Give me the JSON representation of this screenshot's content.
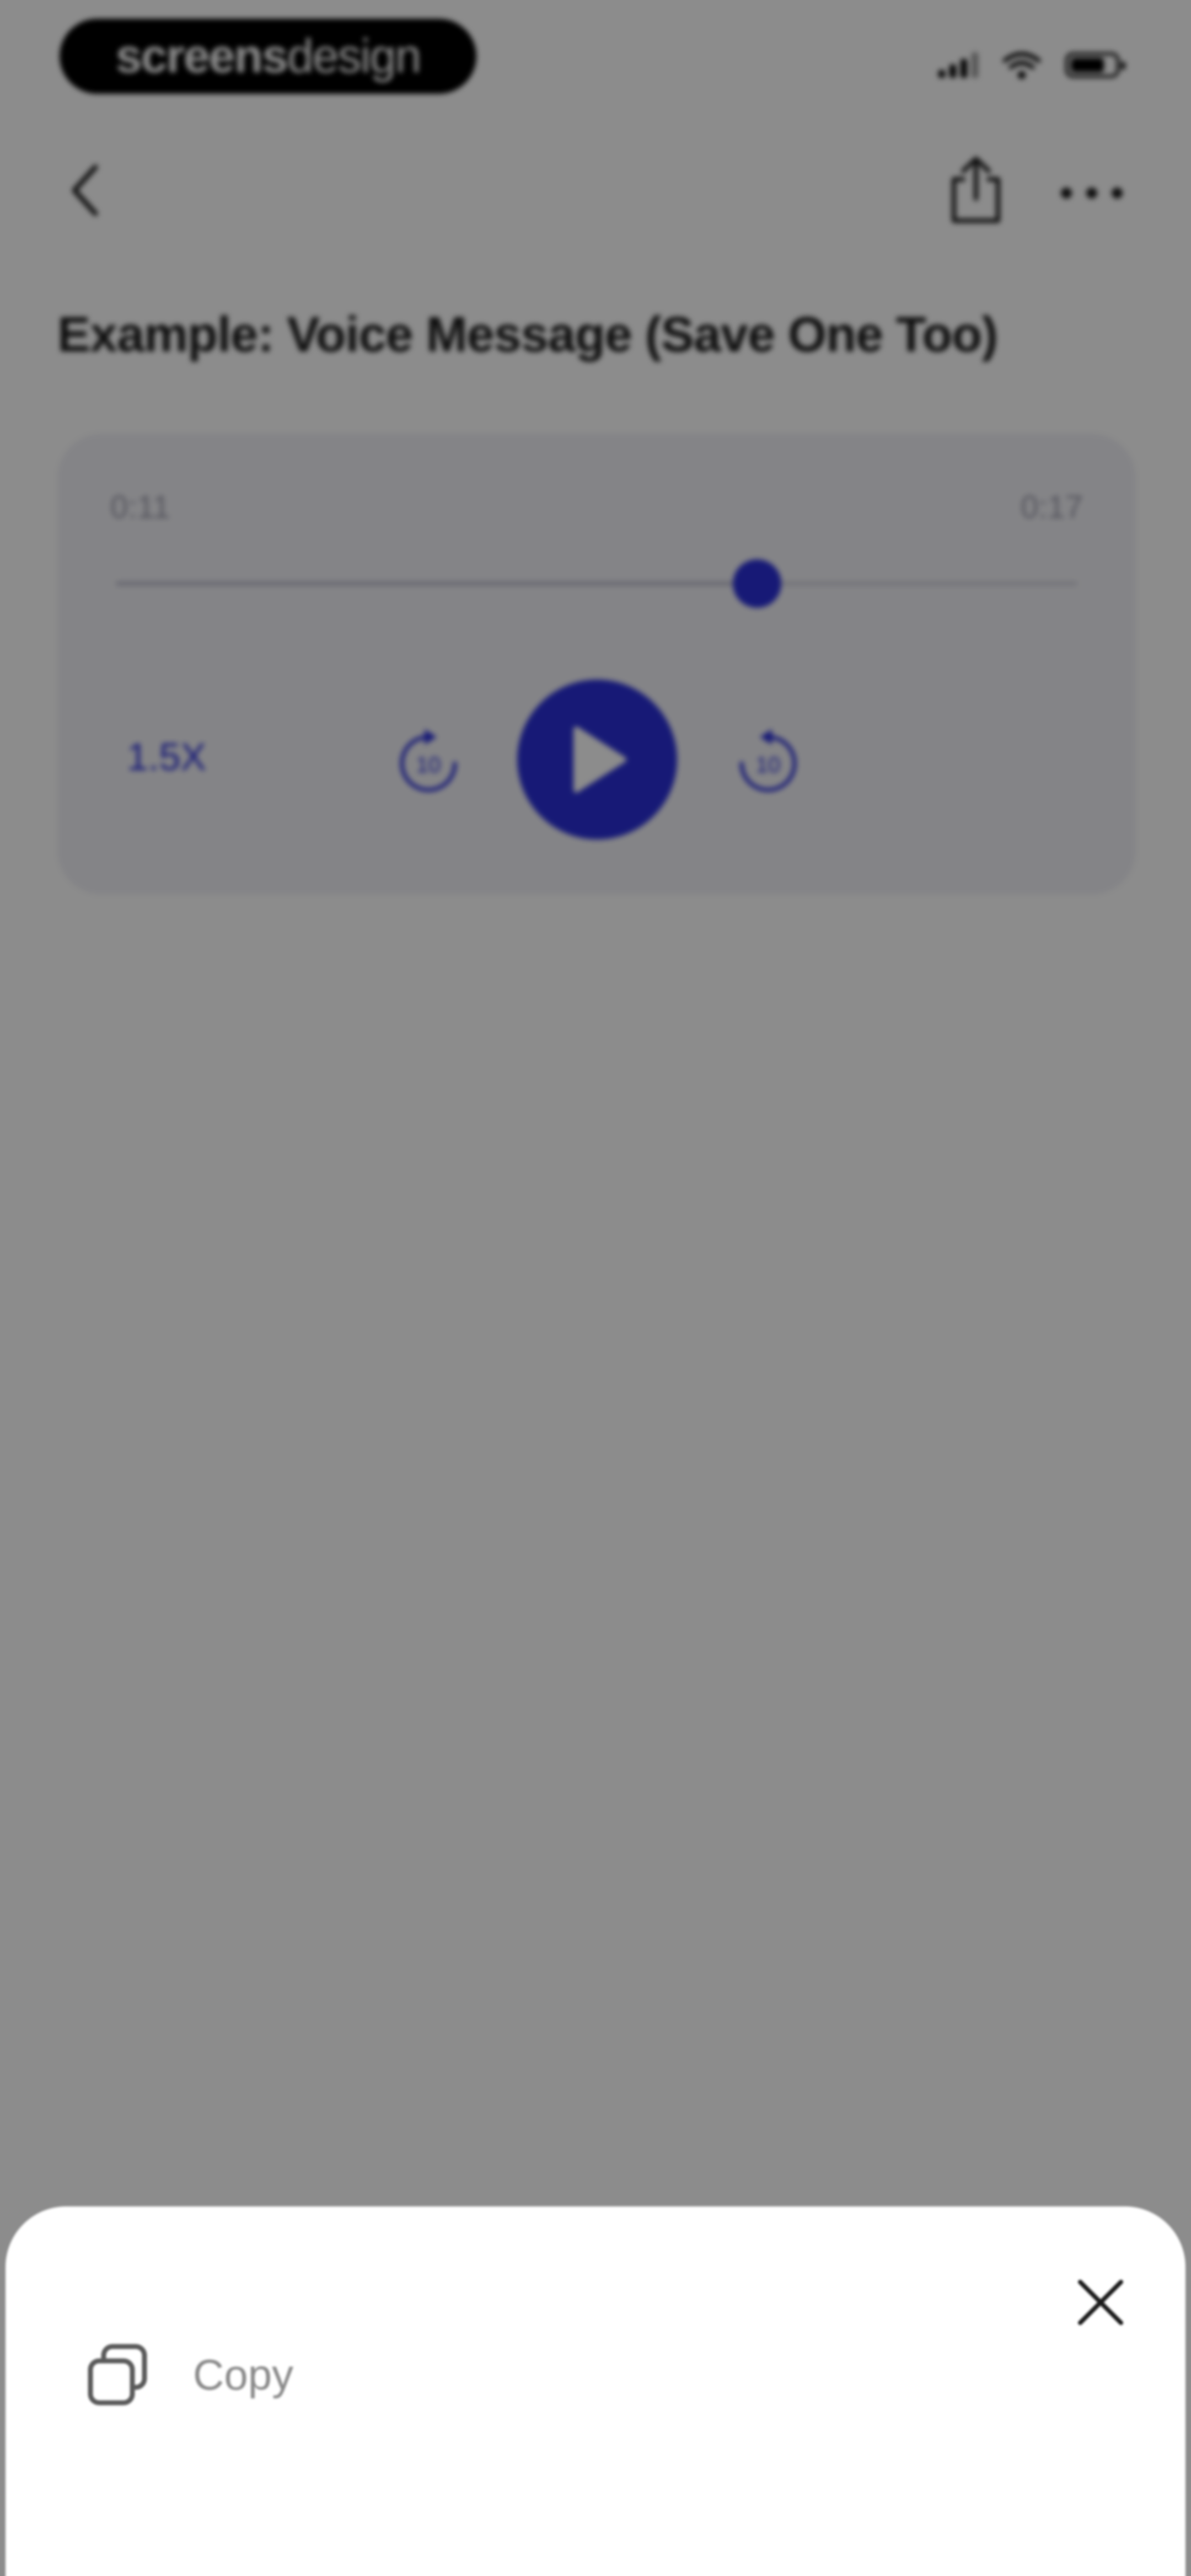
{
  "brand": {
    "part1": "screens",
    "part2": "design"
  },
  "nav": {
    "back_icon": "chevron-left-icon",
    "share_icon": "share-icon",
    "more_icon": "ellipsis-icon"
  },
  "note": {
    "title": "Example: Voice Message (Save One Too)"
  },
  "player": {
    "current_time": "0:11",
    "duration": "0:17",
    "progress_fraction": 0.6667,
    "speed_label": "1.5X",
    "skip_back_label": "10",
    "skip_forward_label": "10",
    "accent_color": "#2a2fd8"
  },
  "sheet": {
    "close_icon": "close-icon",
    "copy_icon": "copy-icon",
    "copy_label": "Copy"
  }
}
